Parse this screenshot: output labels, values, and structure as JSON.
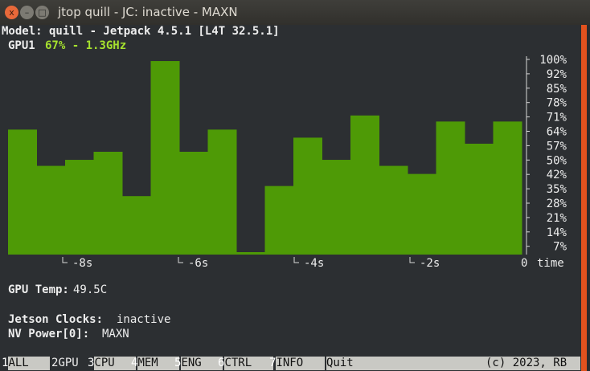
{
  "window": {
    "title": "jtop quill - JC: inactive - MAXN",
    "close_glyph": "x",
    "min_glyph": "–",
    "max_glyph": "□"
  },
  "header": {
    "model_line": "Model: quill - Jetpack 4.5.1 [L4T 32.5.1]",
    "gpu_label": "GPU1",
    "gpu_stats": "67% - 1.3GHz"
  },
  "chart_data": {
    "type": "bar",
    "title": "",
    "xlabel": "time",
    "x_ticks": [
      "-8s",
      "-6s",
      "-4s",
      "-2s",
      "0"
    ],
    "y_ticks": [
      "100%",
      "92%",
      "85%",
      "78%",
      "71%",
      "64%",
      "57%",
      "50%",
      "42%",
      "35%",
      "28%",
      "21%",
      "14%",
      "7%"
    ],
    "ylim": [
      0,
      100
    ],
    "values": [
      62,
      44,
      47,
      51,
      29,
      96,
      51,
      62,
      0,
      34,
      58,
      47,
      69,
      44,
      40,
      66,
      55,
      66
    ],
    "bar_color": "#4e9a06"
  },
  "info": {
    "gpu_temp_label": "GPU Temp:",
    "gpu_temp_value": "49.5C",
    "jetson_clocks_label": "Jetson Clocks:",
    "jetson_clocks_value": "inactive",
    "nvpower_label": "NV Power[0]:",
    "nvpower_value": "MAXN"
  },
  "footer": {
    "tabs": [
      {
        "num": "1",
        "label": "ALL"
      },
      {
        "num": "2",
        "label": "GPU"
      },
      {
        "num": "3",
        "label": "CPU"
      },
      {
        "num": "4",
        "label": "MEM"
      },
      {
        "num": "5",
        "label": "ENG"
      },
      {
        "num": "6",
        "label": "CTRL"
      },
      {
        "num": "7",
        "label": "INFO"
      },
      {
        "num": "",
        "label": "Quit"
      }
    ],
    "copyright": "(c) 2023, RB"
  }
}
